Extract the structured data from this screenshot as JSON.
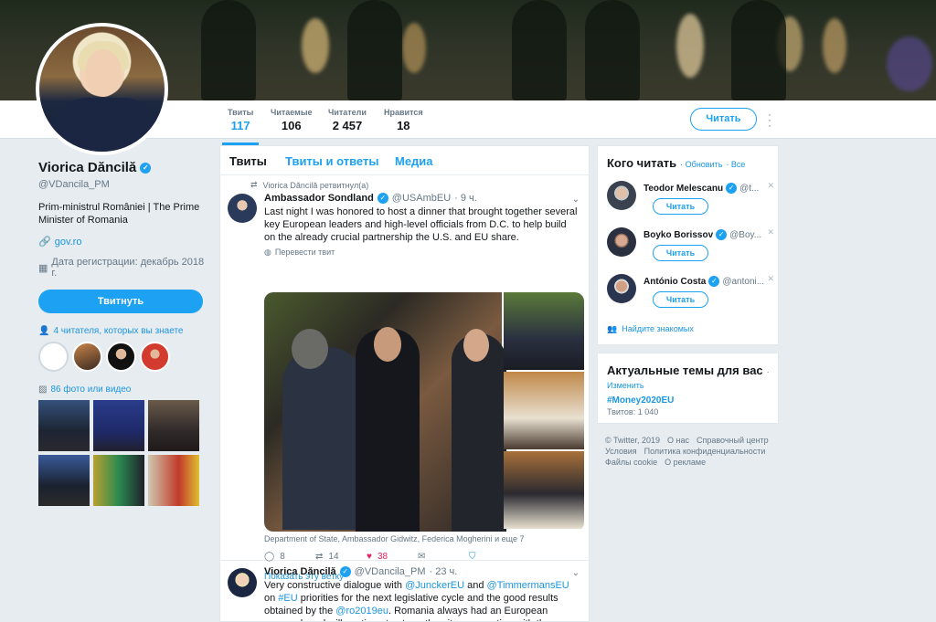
{
  "profile": {
    "name": "Viorica Dăncilă",
    "handle": "@VDancila_PM",
    "bio": "Prim-ministrul României | The Prime Minister of Romania",
    "website": "gov.ro",
    "joined": "Дата регистрации: декабрь 2018 г.",
    "tweet_button": "Твитнуть",
    "followers_you_know": "4 читателя, которых вы знаете",
    "photos_videos": "86 фото или видео"
  },
  "stats": [
    {
      "label": "Твиты",
      "value": "117"
    },
    {
      "label": "Читаемые",
      "value": "106"
    },
    {
      "label": "Читатели",
      "value": "2 457"
    },
    {
      "label": "Нравится",
      "value": "18"
    }
  ],
  "header": {
    "follow_button": "Читать"
  },
  "tabs": [
    "Твиты",
    "Твиты и ответы",
    "Медиа"
  ],
  "tweets": [
    {
      "retweet_by": "Viorica Dăncilă ретвитнул(а)",
      "author": "Ambassador Sondland",
      "handle": "@USAmbEU",
      "time": "· 9 ч.",
      "text": "Last night I was honored to host a dinner that brought together several key European leaders and high-level officials from D.C. to help build on the already crucial partnership the U.S. and EU share.",
      "translate": "Перевести твит",
      "caption": "Department of State, Ambassador Gidwitz, Federica Mogherini и еще 7",
      "replies": "8",
      "retweets": "14",
      "likes": "38",
      "show_thread": "Показать эту ветку"
    },
    {
      "author": "Viorica Dăncilă",
      "handle": "@VDancila_PM",
      "time": "· 23 ч.",
      "text_1": "Very constructive dialogue with ",
      "mention_1": "@JunckerEU",
      "text_2": " and ",
      "mention_2": "@TimmermansEU",
      "text_3": " on ",
      "hashtag_1": "#EU",
      "text_4": " priorities for the next legislative cycle and the good results obtained by the ",
      "mention_3": "@ro2019eu",
      "text_5": ". Romania always had an European approach and will continue to strengthen its cooperation with the European Commission."
    }
  ],
  "who_to_follow": {
    "title": "Кого читать",
    "refresh": "· Обновить",
    "all": "· Все",
    "follow_label": "Читать",
    "accounts": [
      {
        "name": "Teodor Melescanu",
        "handle": "@t..."
      },
      {
        "name": "Boyko Borissov",
        "handle": "@Boy..."
      },
      {
        "name": "António Costa",
        "handle": "@antoni..."
      }
    ],
    "find_friends": "Найдите знакомых"
  },
  "trends": {
    "title": "Актуальные темы для вас",
    "dot": "·",
    "change": "Изменить",
    "items": [
      {
        "tag": "#Money2020EU",
        "count": "Твитов: 1 040"
      }
    ]
  },
  "footer": [
    "© Twitter, 2019",
    "О нас",
    "Справочный центр",
    "Условия",
    "Политика конфиденциальности",
    "Файлы cookie",
    "О рекламе"
  ],
  "colors": {
    "accent": "#1da1f2",
    "like": "#e0245e",
    "background": "#e6ecf0"
  }
}
